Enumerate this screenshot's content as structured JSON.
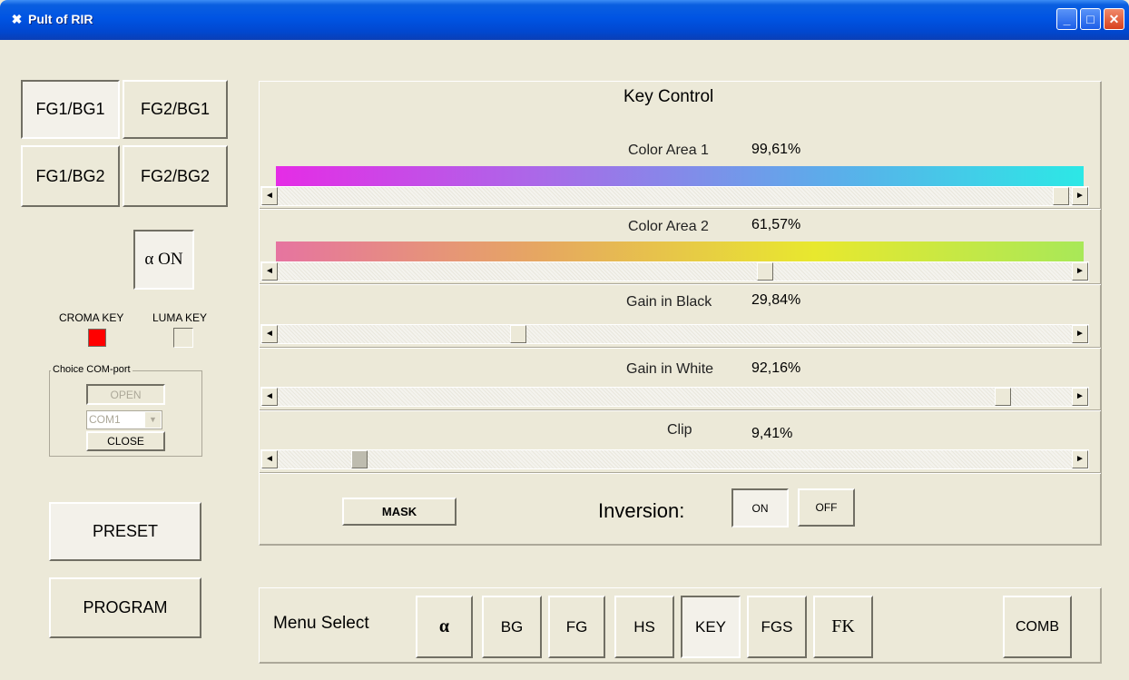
{
  "window": {
    "title": "Pult of RIR",
    "controls": [
      "minimize",
      "maximize",
      "close"
    ]
  },
  "left": {
    "mode_buttons": [
      "FG1/BG1",
      "FG2/BG1",
      "FG1/BG2",
      "FG2/BG2"
    ],
    "alpha_on_label": "α ON",
    "croma_key_label": "CROMA KEY",
    "luma_key_label": "LUMA KEY",
    "croma_indicator_color": "#ff0000",
    "com_group_title": "Choice COM-port",
    "open_label": "OPEN",
    "com_select_value": "COM1",
    "close_label": "CLOSE",
    "preset_label": "PRESET",
    "program_label": "PROGRAM"
  },
  "key_control": {
    "title": "Key Control",
    "sliders": [
      {
        "label": "Color Area 1",
        "value": "99,61%",
        "fraction": 0.9961,
        "gradient": [
          "#e52ce6",
          "#a96ae8",
          "#5fa9ea",
          "#2ce8e6"
        ]
      },
      {
        "label": "Color Area 2",
        "value": "61,57%",
        "fraction": 0.6157,
        "gradient": [
          "#e674a0",
          "#e6a860",
          "#e8e82e",
          "#a8e858"
        ]
      },
      {
        "label": "Gain in Black",
        "value": "29,84%",
        "fraction": 0.2984
      },
      {
        "label": "Gain in White",
        "value": "92,16%",
        "fraction": 0.9216
      },
      {
        "label": "Clip",
        "value": "9,41%",
        "fraction": 0.0941
      }
    ],
    "mask_label": "MASK",
    "inversion_label": "Inversion:",
    "inversion_on": "ON",
    "inversion_off": "OFF"
  },
  "menu": {
    "label": "Menu Select",
    "items": [
      "α",
      "BG",
      "FG",
      "HS",
      "KEY",
      "FGS",
      "FK"
    ],
    "comb_label": "COMB",
    "selected": "KEY"
  },
  "icons": {
    "scroll_left": "◄",
    "scroll_right": "►",
    "dropdown": "▼"
  }
}
